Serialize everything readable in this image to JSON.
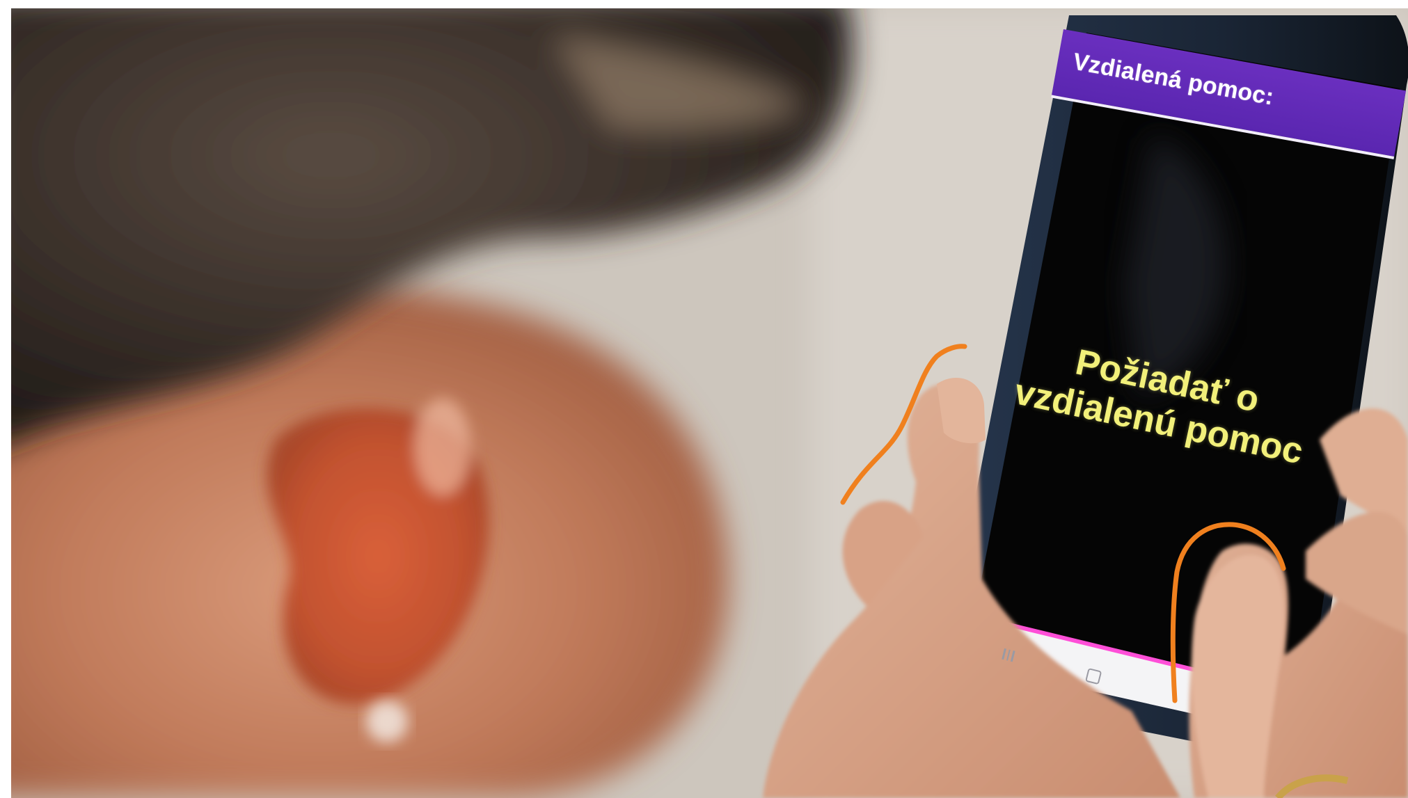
{
  "app": {
    "header_title": "Vzdialená pomoc:",
    "request_button_lines": [
      "Požiadať o",
      "vzdialenú pomoc"
    ]
  },
  "navbar": {
    "recent_icon": "recent-apps-icon",
    "home_icon": "home-icon"
  },
  "colors": {
    "header_bg": "#5a26b0",
    "button_text": "#f2f07a",
    "screen_bg": "#050505",
    "navbar_accent": "#ff4fd8",
    "gesture_stroke": "#f0801e"
  }
}
